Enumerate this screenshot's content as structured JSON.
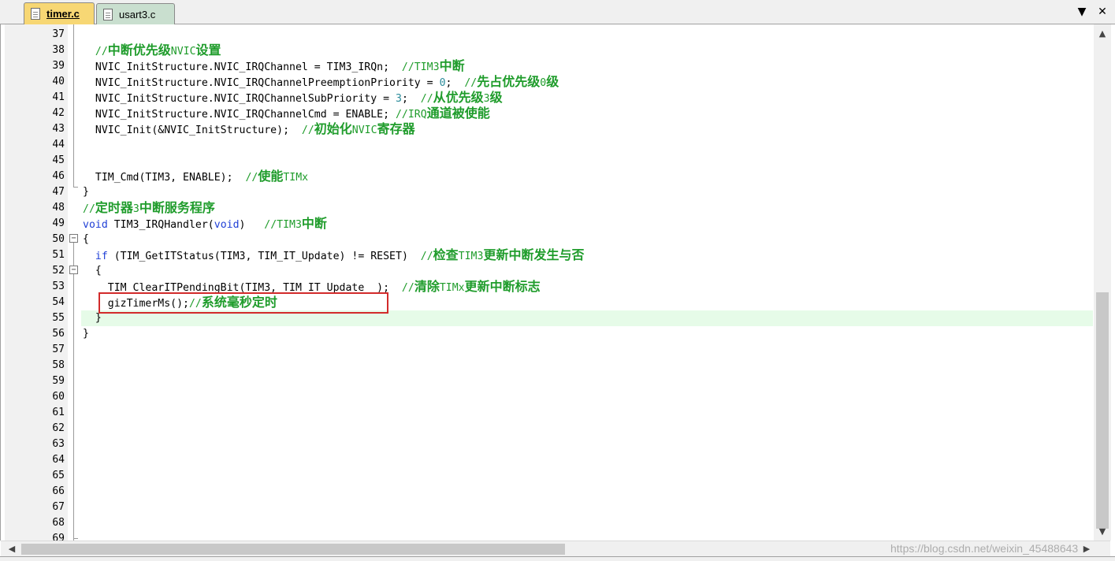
{
  "tabs": [
    {
      "label": "timer.c",
      "active": true
    },
    {
      "label": "usart3.c",
      "active": false
    }
  ],
  "tabbar": {
    "dropdown_icon": "▼",
    "close_icon": "✕"
  },
  "lines": [
    {
      "n": "37",
      "code": []
    },
    {
      "n": "38",
      "code": [
        [
          "cm",
          "  //"
        ],
        [
          "cmz",
          "中断优先级"
        ],
        [
          "cm",
          "NVIC"
        ],
        [
          "cmz",
          "设置"
        ]
      ]
    },
    {
      "n": "39",
      "code": [
        [
          "",
          "  NVIC_InitStructure.NVIC_IRQChannel = TIM3_IRQn;  "
        ],
        [
          "cm",
          "//TIM3"
        ],
        [
          "cmz",
          "中断"
        ]
      ]
    },
    {
      "n": "40",
      "code": [
        [
          "",
          "  NVIC_InitStructure.NVIC_IRQChannelPreemptionPriority = "
        ],
        [
          "num",
          "0"
        ],
        [
          "",
          ";  "
        ],
        [
          "cm",
          "//"
        ],
        [
          "cmz",
          "先占优先级"
        ],
        [
          "cm",
          "0"
        ],
        [
          "cmz",
          "级"
        ]
      ]
    },
    {
      "n": "41",
      "code": [
        [
          "",
          "  NVIC_InitStructure.NVIC_IRQChannelSubPriority = "
        ],
        [
          "num",
          "3"
        ],
        [
          "",
          ";  "
        ],
        [
          "cm",
          "//"
        ],
        [
          "cmz",
          "从优先级"
        ],
        [
          "cm",
          "3"
        ],
        [
          "cmz",
          "级"
        ]
      ]
    },
    {
      "n": "42",
      "code": [
        [
          "",
          "  NVIC_InitStructure.NVIC_IRQChannelCmd = ENABLE; "
        ],
        [
          "cm",
          "//IRQ"
        ],
        [
          "cmz",
          "通道被使能"
        ]
      ]
    },
    {
      "n": "43",
      "code": [
        [
          "",
          "  NVIC_Init(&NVIC_InitStructure);  "
        ],
        [
          "cm",
          "//"
        ],
        [
          "cmz",
          "初始化"
        ],
        [
          "cm",
          "NVIC"
        ],
        [
          "cmz",
          "寄存器"
        ]
      ]
    },
    {
      "n": "44",
      "code": []
    },
    {
      "n": "45",
      "code": []
    },
    {
      "n": "46",
      "code": [
        [
          "",
          "  TIM_Cmd(TIM3, ENABLE);  "
        ],
        [
          "cm",
          "//"
        ],
        [
          "cmz",
          "使能"
        ],
        [
          "cm",
          "TIMx"
        ]
      ]
    },
    {
      "n": "47",
      "code": [
        [
          "",
          "}"
        ]
      ]
    },
    {
      "n": "48",
      "code": [
        [
          "cm",
          "//"
        ],
        [
          "cmz",
          "定时器"
        ],
        [
          "cm",
          "3"
        ],
        [
          "cmz",
          "中断服务程序"
        ]
      ]
    },
    {
      "n": "49",
      "code": [
        [
          "kw",
          "void"
        ],
        [
          "",
          " TIM3_IRQHandler("
        ],
        [
          "kw",
          "void"
        ],
        [
          "",
          ")   "
        ],
        [
          "cm",
          "//TIM3"
        ],
        [
          "cmz",
          "中断"
        ]
      ]
    },
    {
      "n": "50",
      "code": [
        [
          "",
          "{"
        ]
      ]
    },
    {
      "n": "51",
      "code": [
        [
          "",
          "  "
        ],
        [
          "kw",
          "if"
        ],
        [
          "",
          " (TIM_GetITStatus(TIM3, TIM_IT_Update) != RESET)  "
        ],
        [
          "cm",
          "//"
        ],
        [
          "cmz",
          "检查"
        ],
        [
          "cm",
          "TIM3"
        ],
        [
          "cmz",
          "更新中断发生与否"
        ]
      ]
    },
    {
      "n": "52",
      "code": [
        [
          "",
          "  {"
        ]
      ]
    },
    {
      "n": "53",
      "code": [
        [
          "",
          "    TIM_ClearITPendingBit(TIM3, TIM_IT_Update  );  "
        ],
        [
          "cm",
          "//"
        ],
        [
          "cmz",
          "清除"
        ],
        [
          "cm",
          "TIMx"
        ],
        [
          "cmz",
          "更新中断标志"
        ]
      ]
    },
    {
      "n": "54",
      "code": [
        [
          "",
          "    gizTimerMs();"
        ],
        [
          "cm",
          "//"
        ],
        [
          "cmz",
          "系统毫秒定时"
        ]
      ]
    },
    {
      "n": "55",
      "code": [
        [
          "",
          "  }"
        ]
      ]
    },
    {
      "n": "56",
      "code": [
        [
          "",
          "}"
        ]
      ]
    },
    {
      "n": "57",
      "code": []
    },
    {
      "n": "58",
      "code": []
    },
    {
      "n": "59",
      "code": []
    },
    {
      "n": "60",
      "code": []
    },
    {
      "n": "61",
      "code": []
    },
    {
      "n": "62",
      "code": []
    },
    {
      "n": "63",
      "code": []
    },
    {
      "n": "64",
      "code": []
    },
    {
      "n": "65",
      "code": []
    },
    {
      "n": "66",
      "code": []
    },
    {
      "n": "67",
      "code": []
    },
    {
      "n": "68",
      "code": []
    },
    {
      "n": "69",
      "code": []
    }
  ],
  "scroll": {
    "up": "▲",
    "down": "▼",
    "left": "◀",
    "right": "▶"
  },
  "watermark": "https://blog.csdn.net/weixin_45488643"
}
